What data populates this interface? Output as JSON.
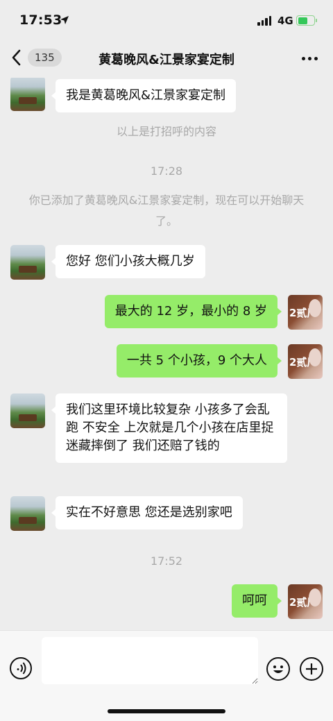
{
  "status_bar": {
    "time": "17:53",
    "network": "4G",
    "battery_level": 0.62,
    "battery_color": "#34c759"
  },
  "nav": {
    "unread_count": "135",
    "title": "黄葛晚风&江景家宴定制",
    "more_icon": "more-icon",
    "back_icon": "chevron-left-icon"
  },
  "messages": [
    {
      "type": "in",
      "text": "我是黄葛晚风&江景家宴定制"
    },
    {
      "type": "system",
      "text": "以上是打招呼的内容"
    },
    {
      "type": "time",
      "text": "17:28"
    },
    {
      "type": "system",
      "text": "你已添加了黄葛晚风&江景家宴定制，现在可以开始聊天了。"
    },
    {
      "type": "in",
      "text": "您好 您们小孩大概几岁"
    },
    {
      "type": "out",
      "text": "最大的 12 岁，最小的 8 岁"
    },
    {
      "type": "out",
      "text": "一共 5 个小孩，9 个大人"
    },
    {
      "type": "in",
      "text": "我们这里环境比较复杂 小孩多了会乱跑 不安全 上次就是几个小孩在店里捉迷藏摔倒了 我们还赔了钱的"
    },
    {
      "type": "in",
      "text": "实在不好意思 您还是选别家吧"
    },
    {
      "type": "time",
      "text": "17:52"
    },
    {
      "type": "out",
      "text": "呵呵"
    }
  ],
  "self_avatar_text": "2贰厂",
  "input": {
    "placeholder": ""
  },
  "colors": {
    "chat_bg": "#ededed",
    "bubble_out": "#95ec69",
    "bubble_in": "#ffffff",
    "system_text": "#a8a8a8"
  }
}
